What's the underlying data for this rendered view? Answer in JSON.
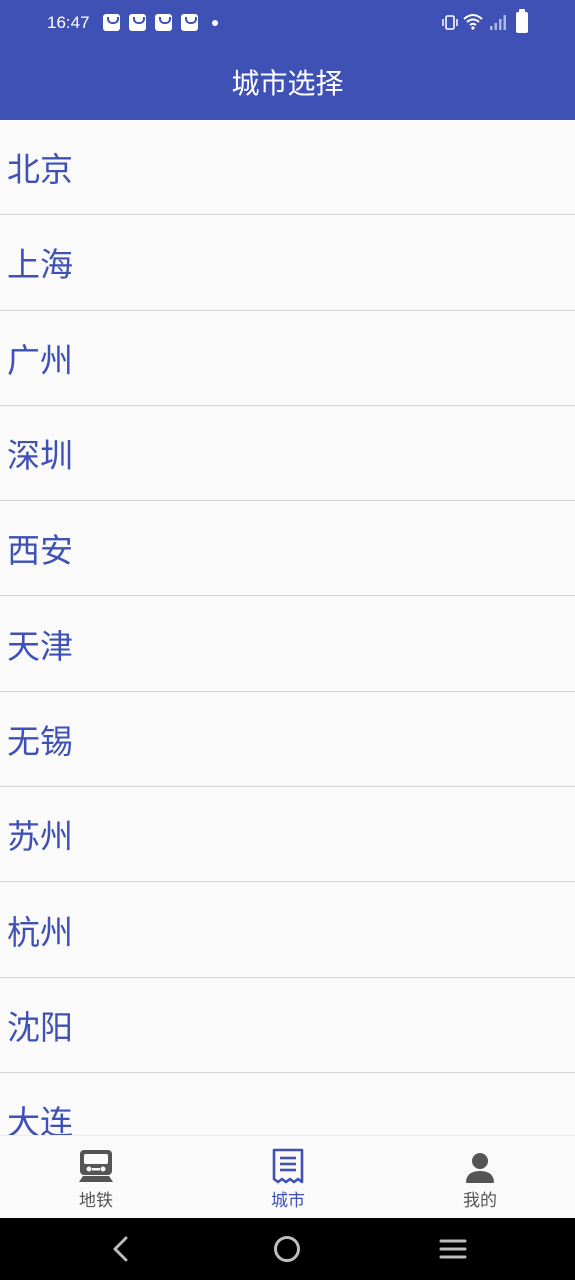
{
  "status_bar": {
    "time": "16:47"
  },
  "app_bar": {
    "title": "城市选择"
  },
  "cities": [
    "北京",
    "上海",
    "广州",
    "深圳",
    "西安",
    "天津",
    "无锡",
    "苏州",
    "杭州",
    "沈阳",
    "大连"
  ],
  "bottom_nav": {
    "items": [
      {
        "label": "地铁",
        "icon": "train-icon"
      },
      {
        "label": "城市",
        "icon": "list-icon",
        "active": true
      },
      {
        "label": "我的",
        "icon": "person-icon"
      }
    ]
  },
  "colors": {
    "primary": "#3f51b5",
    "background": "#fafafa",
    "nav_inactive": "#555555"
  }
}
